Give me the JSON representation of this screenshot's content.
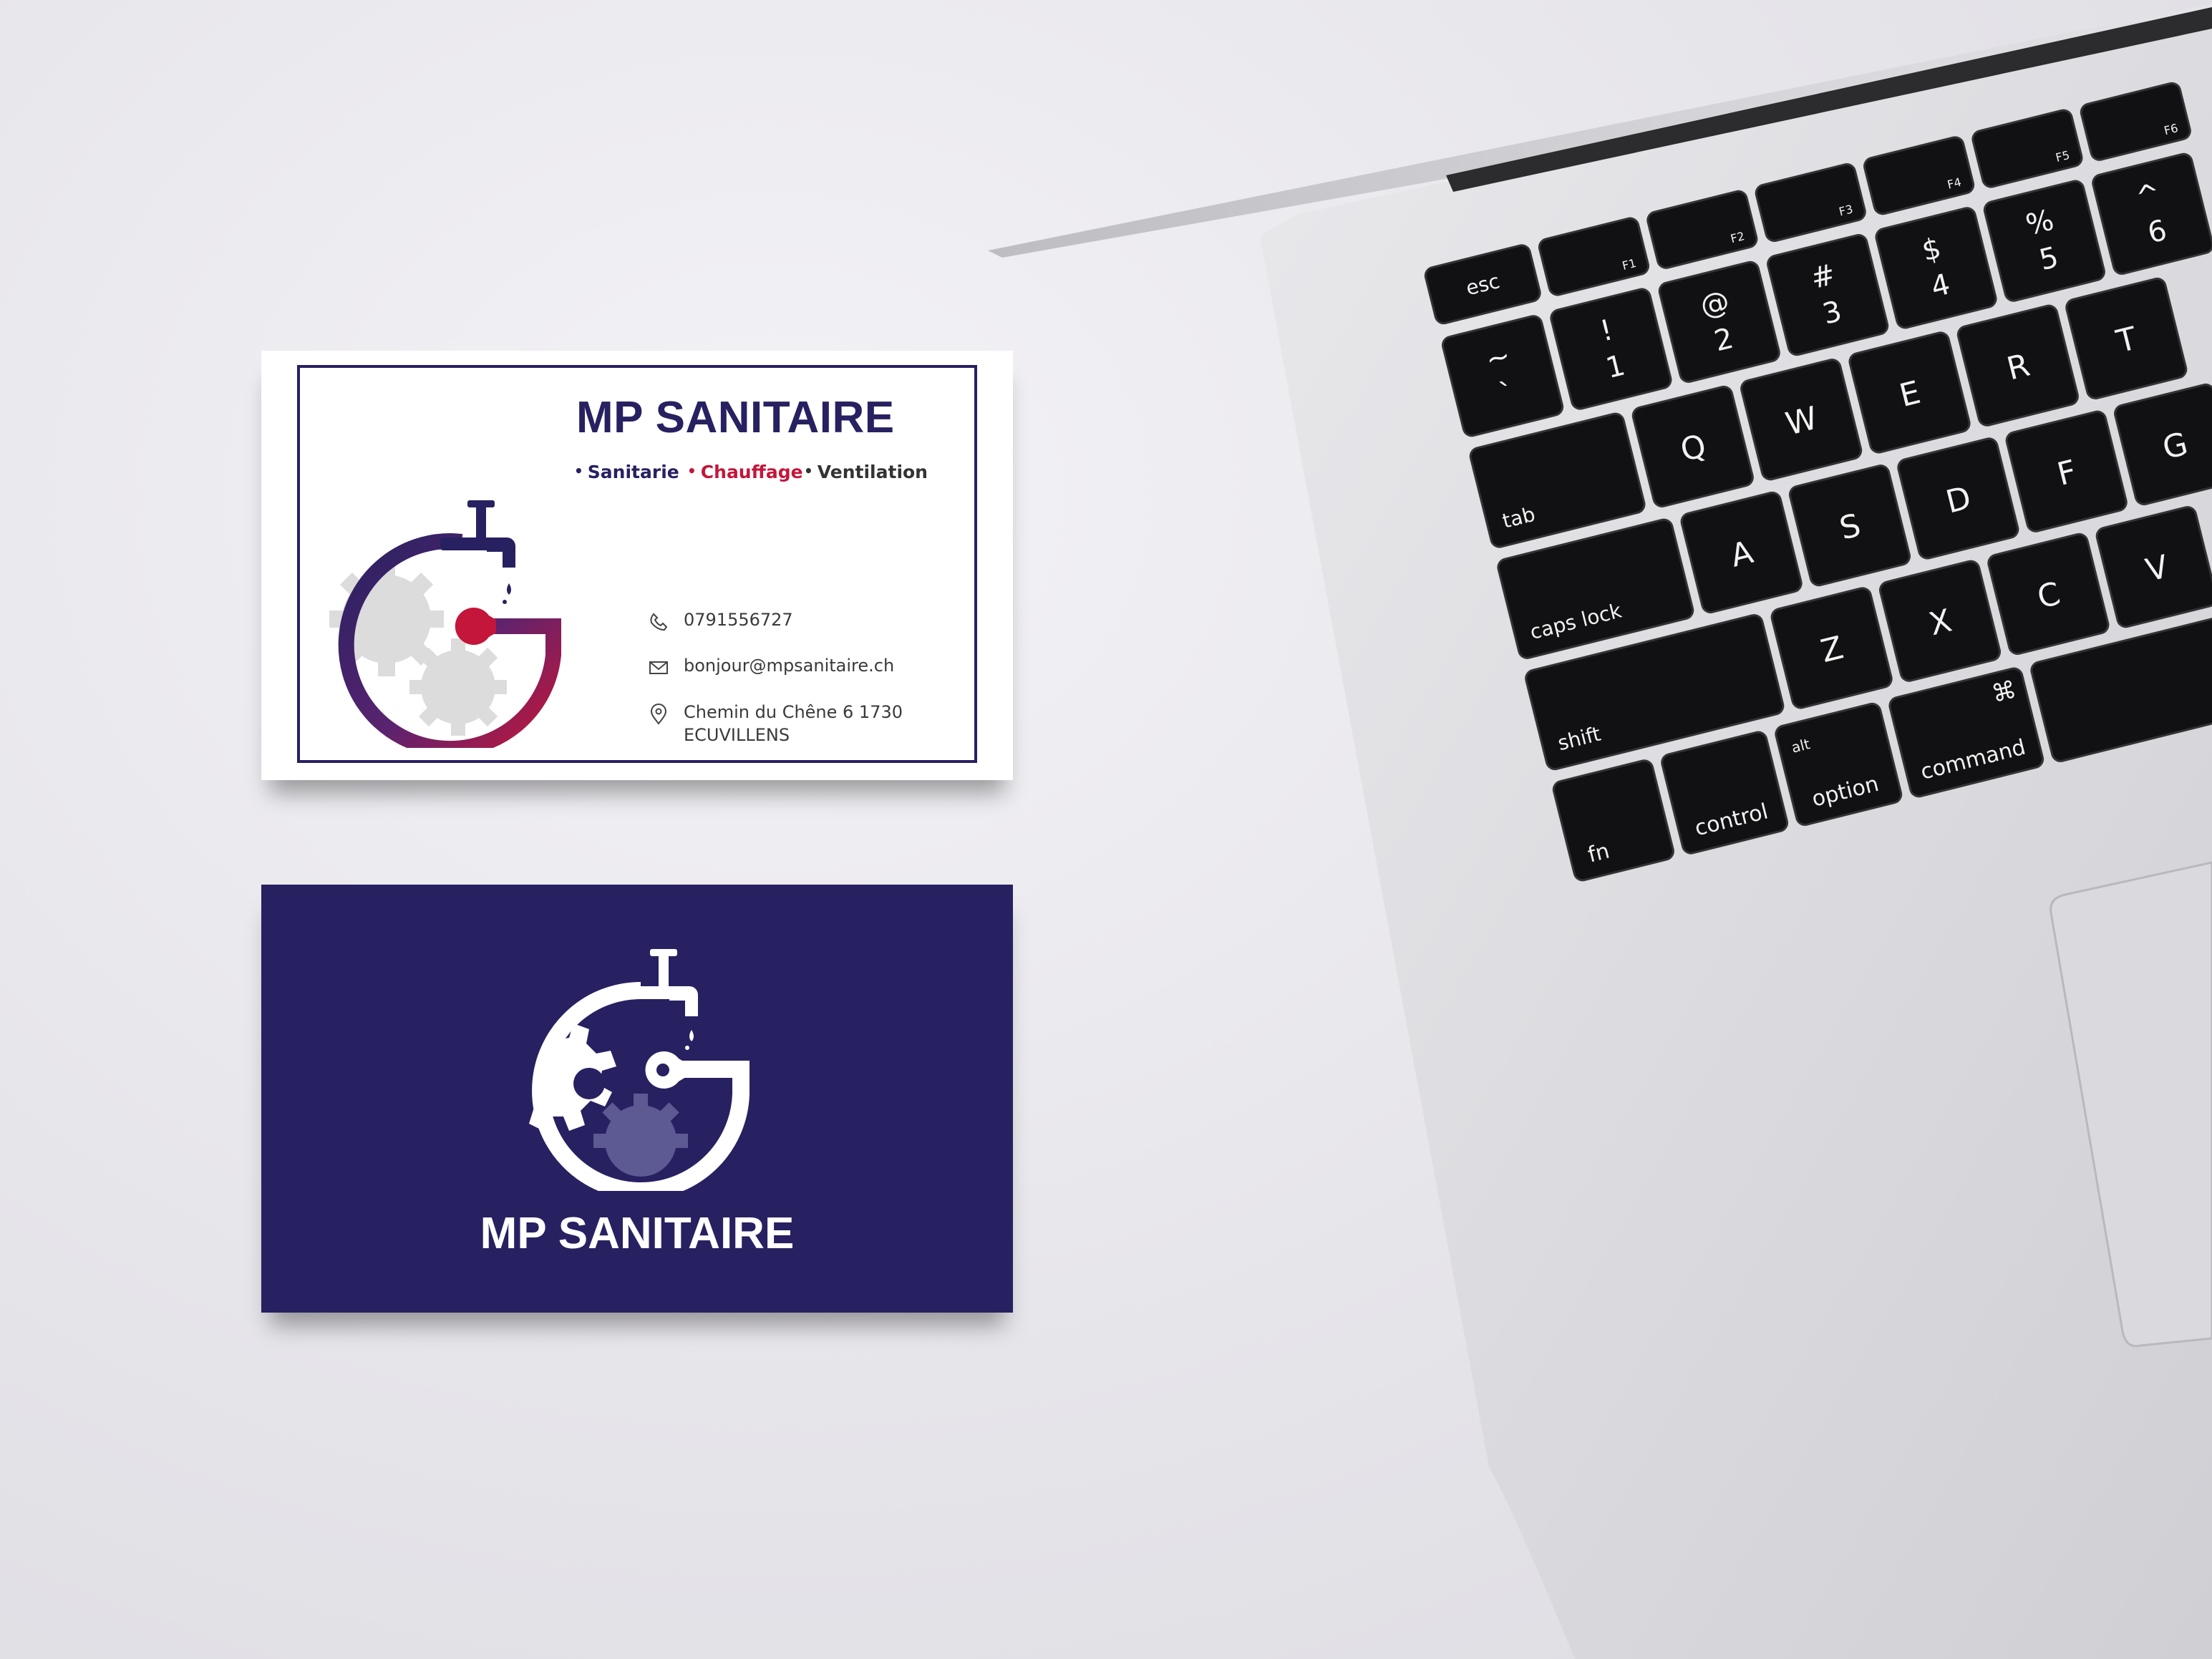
{
  "front": {
    "title": "MP SANITAIRE",
    "services": [
      {
        "label": "Sanitarie",
        "color": "#272161"
      },
      {
        "label": "Chauffage",
        "color": "#c4163a"
      },
      {
        "label": "Ventilation",
        "color": "#333333"
      }
    ],
    "phone": "0791556727",
    "email": "bonjour@mpsanitaire.ch",
    "address_line1": "Chemin du Chêne 6 1730",
    "address_line2": "ECUVILLENS"
  },
  "back": {
    "title": "MP SANITAIRE"
  },
  "colors": {
    "navy": "#272161",
    "red": "#c4163a",
    "paper": "#ffffff"
  },
  "keyboard": {
    "row_fn": [
      "esc",
      "F1",
      "F2",
      "F3",
      "F4",
      "F5",
      "F6"
    ],
    "row_num": [
      {
        "top": "~",
        "bottom": "`"
      },
      {
        "top": "!",
        "bottom": "1"
      },
      {
        "top": "@",
        "bottom": "2"
      },
      {
        "top": "#",
        "bottom": "3"
      },
      {
        "top": "$",
        "bottom": "4"
      },
      {
        "top": "%",
        "bottom": "5"
      },
      {
        "top": "^",
        "bottom": "6"
      }
    ],
    "row_q": [
      "tab",
      "Q",
      "W",
      "E",
      "R",
      "T"
    ],
    "row_a": [
      "caps lock",
      "A",
      "S",
      "D",
      "F",
      "G"
    ],
    "row_z": [
      "shift",
      "Z",
      "X",
      "C",
      "V"
    ],
    "row_bottom": [
      {
        "label": "fn"
      },
      {
        "label": "control"
      },
      {
        "label": "option",
        "sub": "alt"
      },
      {
        "label": "command",
        "sub": "⌘"
      }
    ]
  }
}
